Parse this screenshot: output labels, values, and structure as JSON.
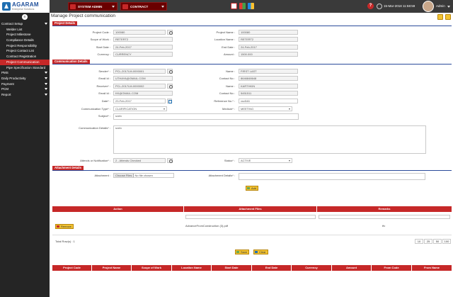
{
  "brand": {
    "name": "AGARAM",
    "tagline": "Enterprise Solutions"
  },
  "topbar": {
    "module": "SYSTEM ADMIN",
    "submodule": "CONTRACT",
    "help": "?",
    "datetime": "15-Mar-2018 11:58:59",
    "user": "Admin"
  },
  "sidebar": {
    "toggle": "≡",
    "items": [
      {
        "label": "Contract Setup",
        "chev": true
      },
      {
        "label": "Welder List"
      },
      {
        "label": "Project Milestone"
      },
      {
        "label": "Compliance Details"
      },
      {
        "label": "Project Responsibility"
      },
      {
        "label": "Project Contact List"
      },
      {
        "label": "Contract Registration"
      },
      {
        "label": "Project Communication"
      },
      {
        "label": "Pipe Specification Standard"
      },
      {
        "label": "PMS",
        "chev": true
      },
      {
        "label": "Daily Productivity",
        "chev": true
      },
      {
        "label": "Payment",
        "chev": true
      },
      {
        "label": "PCM",
        "chev": true
      },
      {
        "label": "Report",
        "chev": true
      }
    ]
  },
  "page": {
    "title": "Manage Project communication"
  },
  "project_details": {
    "header": "Project Details",
    "project_code_label": "Project Code :",
    "project_code": "100080",
    "scope_label": "Scope of Work :",
    "scope": "RETERT2",
    "start_label": "Start Date :",
    "start": "24-Feb-2017",
    "currency_label": "Currency :",
    "currency": "CURRENCY",
    "project_name_label": "Project Name :",
    "project_name": "100080",
    "location_label": "Location Name :",
    "location": "RETERT2",
    "end_label": "End Date :",
    "end": "24-Feb-2017",
    "amount_label": "Amount :",
    "amount": "1500.000"
  },
  "comm": {
    "header": "Communication Details",
    "sender_label": "Sender* :",
    "sender": "PCL-2017LM-0000001",
    "email1_label": "Email Id :",
    "email1": "UTHAYA@GMAIL.COM",
    "receiver_label": "Receiver* :",
    "receiver": "PCL-2017LM-0000002",
    "email2_label": "Email Id :",
    "email2": "KK@GMAIL.COM",
    "date_label": "Date* :",
    "date": "23-Feb-2017",
    "type_label": "Communication Type* :",
    "type": "CLARIFICATION",
    "subject_label": "Subject* :",
    "subject": "sveiv",
    "details_label": "Communication Details* :",
    "details": "sveiv",
    "attn_label": "Attends or Notification* :",
    "attn": "2 - Attends Checked",
    "name1_label": "Name :",
    "name1": "FIRST LAST",
    "contact1_label": "Contact No :",
    "contact1": "8646848648",
    "name2_label": "Name :",
    "name2": "KARTHKIN",
    "contact2_label": "Contact No :",
    "contact2": "5451511",
    "ref_label": "Reference No.* :",
    "ref": "vsv546",
    "medium_label": "Medium* :",
    "medium": "MEETING",
    "status_label": "Status* :",
    "status": "ACTIVE"
  },
  "attach": {
    "header": "Attachment Details",
    "attach_label": "Attachment :",
    "choose": "Choose Files",
    "nofile": "No file chosen",
    "details_label": "Attachment Details* :",
    "add": "Add",
    "cols": [
      "Action",
      "Attachment Files",
      "Remarks"
    ],
    "row": {
      "action": "Remove",
      "file": "AdvanceFromConstruction (3).pdf",
      "remarks": "tfv"
    },
    "total": "Total Row(s) : 1",
    "pages": [
      "10",
      "25",
      "50",
      "100"
    ]
  },
  "footer": {
    "save": "Save",
    "clear": "Clear"
  },
  "grid": {
    "cols": [
      "Project Code",
      "Project Name",
      "Scope of Work",
      "Location Name",
      "Start Date",
      "End Date",
      "Currency",
      "Amount",
      "From Code",
      "From Name"
    ]
  }
}
